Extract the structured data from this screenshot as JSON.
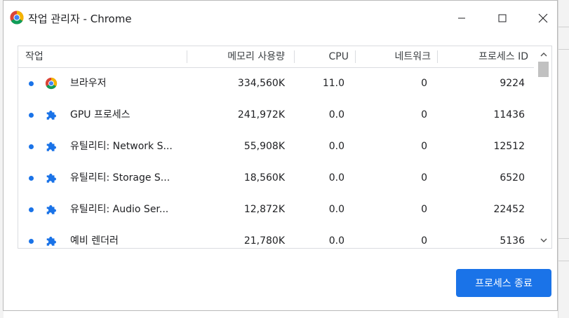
{
  "window": {
    "title": "작업 관리자 - Chrome",
    "controls": {
      "minimize_icon": "minimize-icon",
      "maximize_icon": "maximize-icon",
      "close_icon": "close-icon"
    }
  },
  "table": {
    "columns": {
      "task": "작업",
      "memory": "메모리 사용량",
      "cpu": "CPU",
      "network": "네트워크",
      "pid": "프로세스 ID"
    },
    "rows": [
      {
        "name": "브라우저",
        "icon": "chrome-icon",
        "memory": "334,560K",
        "cpu": "11.0",
        "network": "0",
        "pid": "9224"
      },
      {
        "name": "GPU 프로세스",
        "icon": "puzzle-icon",
        "memory": "241,972K",
        "cpu": "0.0",
        "network": "0",
        "pid": "11436"
      },
      {
        "name": "유틸리티: Network S...",
        "icon": "puzzle-icon",
        "memory": "55,908K",
        "cpu": "0.0",
        "network": "0",
        "pid": "12512"
      },
      {
        "name": "유틸리티: Storage S...",
        "icon": "puzzle-icon",
        "memory": "18,560K",
        "cpu": "0.0",
        "network": "0",
        "pid": "6520"
      },
      {
        "name": "유틸리티: Audio Ser...",
        "icon": "puzzle-icon",
        "memory": "12,872K",
        "cpu": "0.0",
        "network": "0",
        "pid": "22452"
      },
      {
        "name": "예비 렌더러",
        "icon": "puzzle-icon",
        "memory": "21,780K",
        "cpu": "0.0",
        "network": "0",
        "pid": "5136"
      }
    ]
  },
  "actions": {
    "end_process_label": "프로세스 종료"
  },
  "colors": {
    "accent": "#1a73e8",
    "border": "#dadce0",
    "text": "#202124"
  }
}
